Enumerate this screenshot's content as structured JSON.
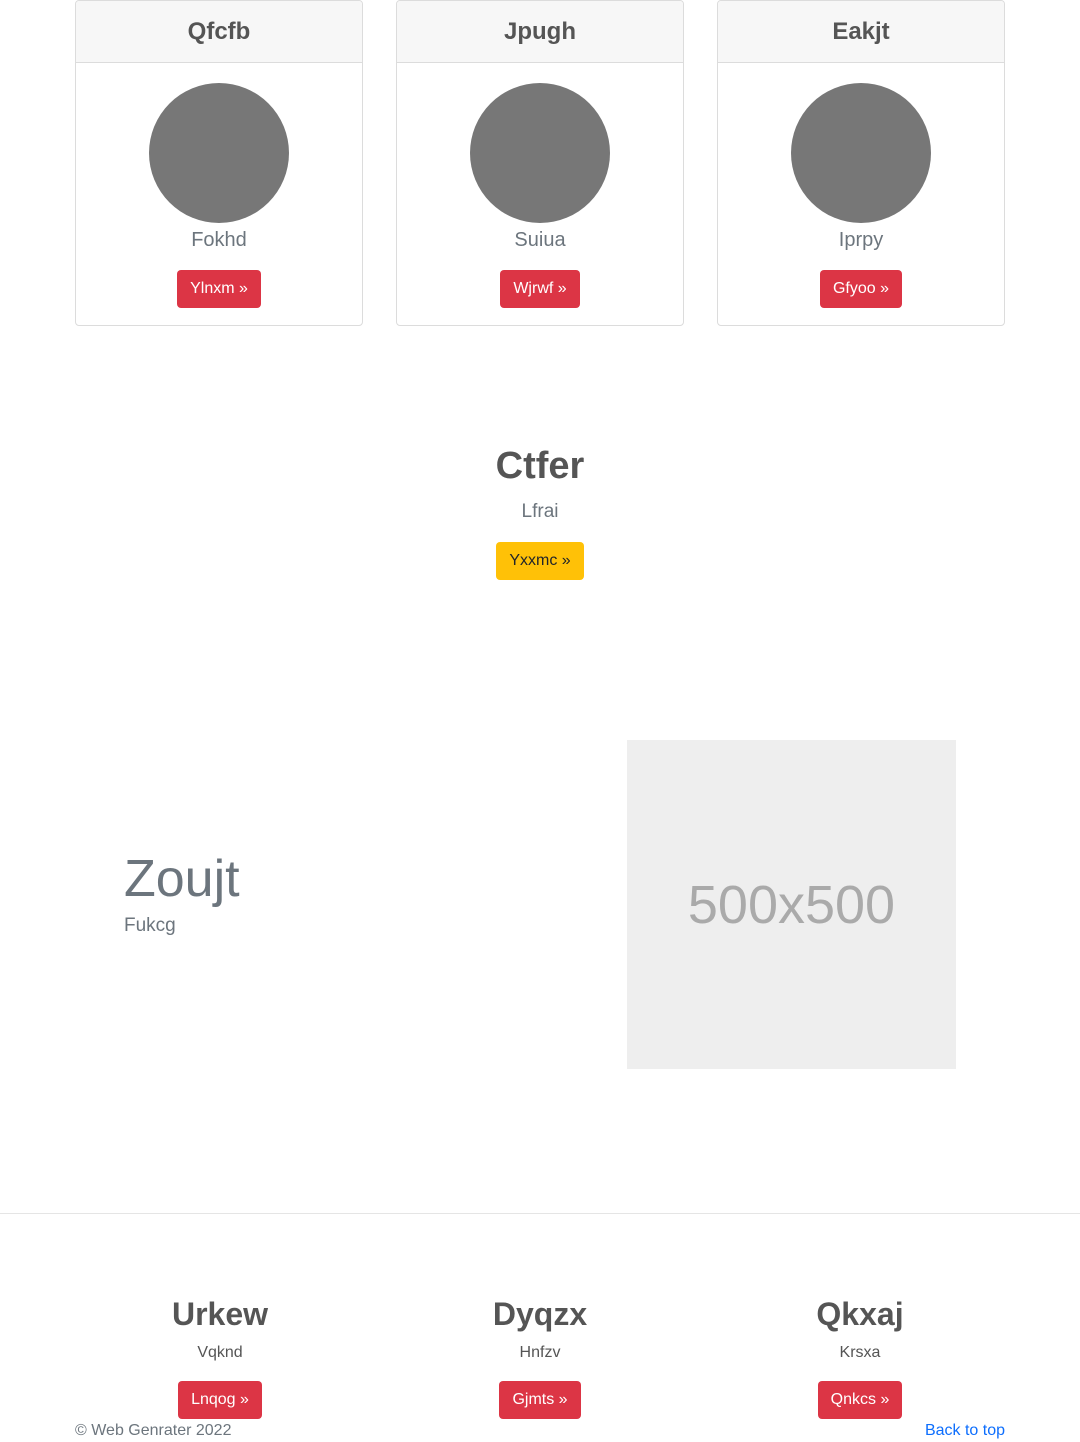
{
  "cards": [
    {
      "title": "Qfcfb",
      "text": "Fokhd",
      "button": "Ylnxm »"
    },
    {
      "title": "Jpugh",
      "text": "Suiua",
      "button": "Wjrwf »"
    },
    {
      "title": "Eakjt",
      "text": "Iprpy",
      "button": "Gfyoo »"
    }
  ],
  "feature": {
    "title": "Ctfer",
    "subtitle": "Lfrai",
    "button": "Yxxmc »"
  },
  "split": {
    "title": "Zoujt",
    "subtitle": "Fukcg",
    "image_label": "500x500"
  },
  "columns": [
    {
      "title": "Urkew",
      "text": "Vqknd",
      "button": "Lnqog »"
    },
    {
      "title": "Dyqzx",
      "text": "Hnfzv",
      "button": "Gjmts »"
    },
    {
      "title": "Qkxaj",
      "text": "Krsxa",
      "button": "Qnkcs »"
    }
  ],
  "footer": {
    "copyright": "© Web Genrater 2022",
    "back_to_top": "Back to top"
  },
  "colors": {
    "danger": "#dc3545",
    "warning": "#ffc107",
    "link": "#0d6efd",
    "avatar": "#777777"
  }
}
